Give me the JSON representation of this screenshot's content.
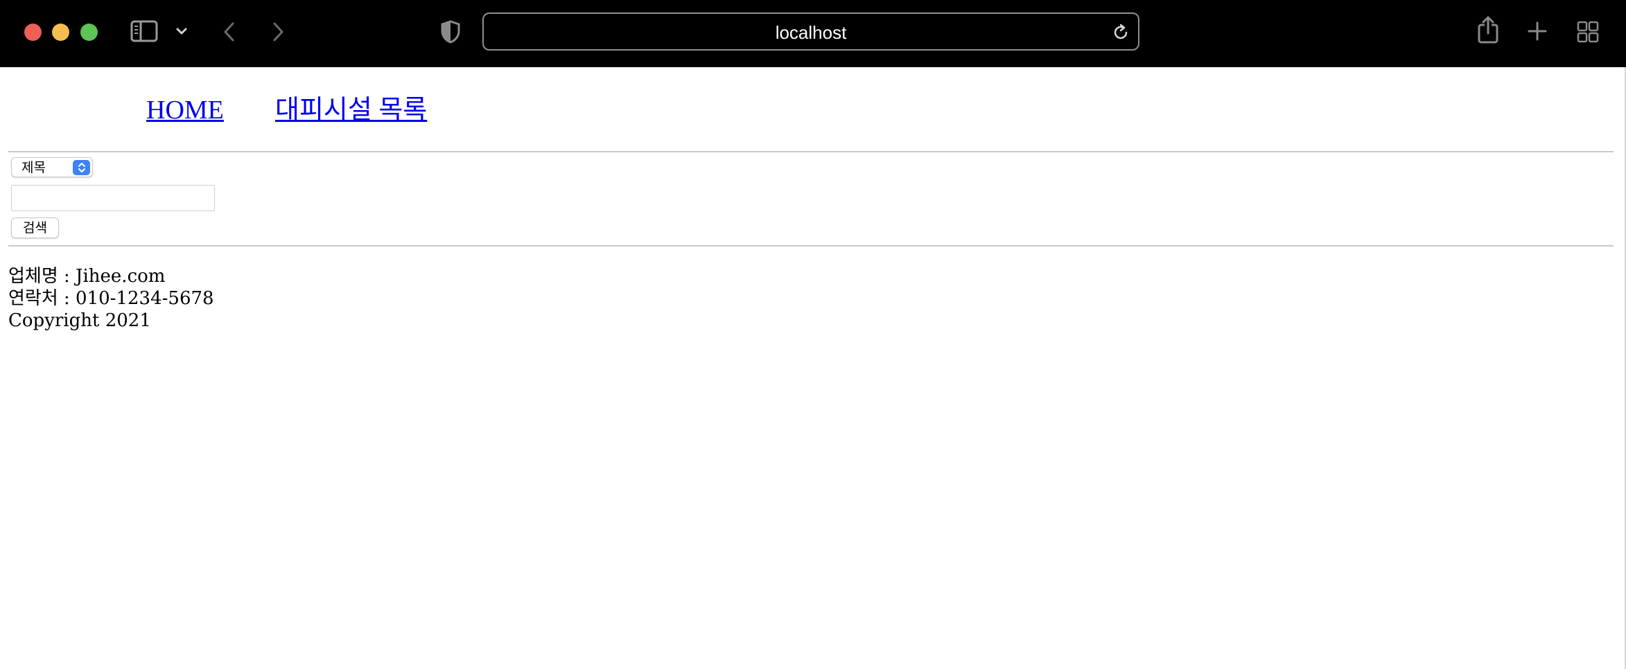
{
  "browser": {
    "url": "localhost",
    "icons": {
      "sidebar": "sidebar-icon",
      "tab_overview_chevron": "chevron-down-icon",
      "back": "chevron-left-icon",
      "forward": "chevron-right-icon",
      "privacy": "shield-icon",
      "reload": "reload-icon",
      "share": "share-icon",
      "new_tab": "plus-icon",
      "tab_overview": "grid-icon"
    },
    "colors": {
      "close": "#ee5f57",
      "minimize": "#f4be4f",
      "zoom": "#5ec454"
    }
  },
  "nav": {
    "home": "HOME",
    "shelter_list": "대피시설 목록",
    "link_color": "#0000ee"
  },
  "search": {
    "field_select_value": "제목",
    "query_value": "",
    "submit_label": "검색",
    "select_accent": "#3d82f6"
  },
  "footer": {
    "company": "업체명 : Jihee.com",
    "contact": "연락처 : 010-1234-5678",
    "copyright": "Copyright 2021"
  }
}
